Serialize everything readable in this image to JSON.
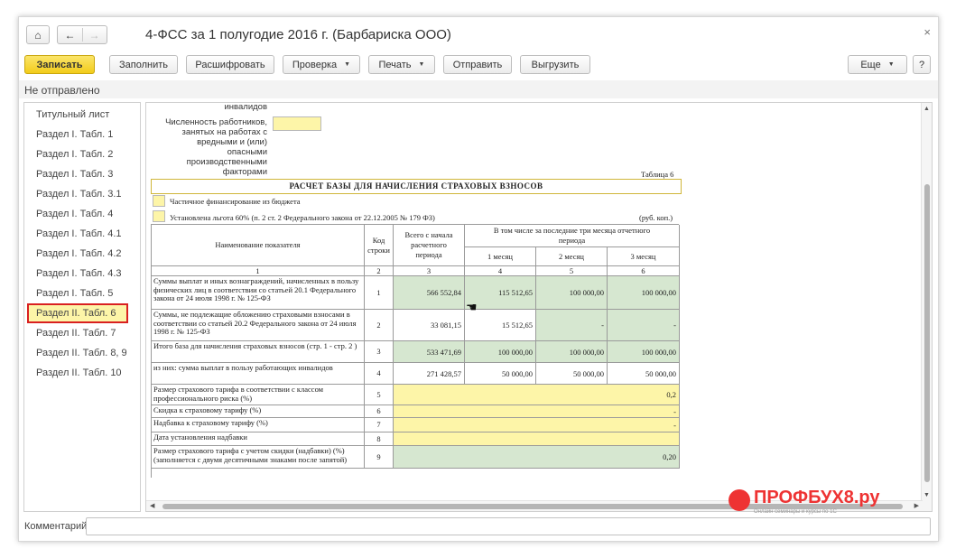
{
  "window": {
    "title": "4-ФСС за 1 полугодие 2016 г. (Барбариска ООО)",
    "close_glyph": "×"
  },
  "nav": {
    "home_glyph": "⌂",
    "back_glyph": "←",
    "forward_glyph": "→"
  },
  "toolbar": {
    "save": "Записать",
    "fill": "Заполнить",
    "decode": "Расшифровать",
    "check": "Проверка",
    "print": "Печать",
    "send": "Отправить",
    "upload": "Выгрузить",
    "more": "Еще",
    "help": "?"
  },
  "status": "Не отправлено",
  "sidebar": {
    "items": [
      {
        "label": "Титульный лист"
      },
      {
        "label": "Раздел I. Табл. 1"
      },
      {
        "label": "Раздел I. Табл. 2"
      },
      {
        "label": "Раздел I. Табл. 3"
      },
      {
        "label": "Раздел I. Табл. 3.1"
      },
      {
        "label": "Раздел I. Табл. 4"
      },
      {
        "label": "Раздел I. Табл. 4.1"
      },
      {
        "label": "Раздел I. Табл. 4.2"
      },
      {
        "label": "Раздел I. Табл. 4.3"
      },
      {
        "label": "Раздел I. Табл. 5"
      },
      {
        "label": "Раздел II. Табл. 6"
      },
      {
        "label": "Раздел II. Табл. 7"
      },
      {
        "label": "Раздел II. Табл. 8, 9"
      },
      {
        "label": "Раздел II. Табл. 10"
      }
    ],
    "active_index": 10
  },
  "form": {
    "truncated_label": "инвалидов",
    "workers_label": "Численность работников, занятых на работах с вредными и (или) опасными производственными факторами",
    "table_number": "Таблица 6",
    "calc_title": "РАСЧЕТ БАЗЫ ДЛЯ НАЧИСЛЕНИЯ СТРАХОВЫХ ВЗНОСОВ",
    "partial_financing": "Частичное финансирование из бюджета",
    "benefit": "Установлена льгота 60% (п. 2 ст. 2 Федерального закона от 22.12.2005 № 179 ФЗ)",
    "currency": "(руб. коп.)"
  },
  "table": {
    "headers": {
      "name": "Наименование показателя",
      "code": "Код строки",
      "total": "Всего с начала расчетного периода",
      "last_three": "В том числе за последние три месяца отчетного периода",
      "m1": "1 месяц",
      "m2": "2 месяц",
      "m3": "3 месяц"
    },
    "col_numbers": [
      "1",
      "2",
      "3",
      "4",
      "5",
      "6"
    ],
    "rows": [
      {
        "name": "Суммы выплат и иных вознаграждений, начисленных в пользу физических лиц в соответствии со статьей 20.1 Федерального закона от 24 июля 1998 г. № 125-ФЗ",
        "code": "1",
        "total": "566 552,84",
        "m1": "115 512,65",
        "m2": "100 000,00",
        "m3": "100 000,00"
      },
      {
        "name": "Суммы, не подлежащие обложению страховыми взносами в соответствии со статьей 20.2 Федерального закона от 24 июля 1998 г. № 125-ФЗ",
        "code": "2",
        "total": "33 081,15",
        "m1": "15 512,65",
        "m2": "-",
        "m3": "-"
      },
      {
        "name": "Итого база для начисления страховых взносов (стр. 1 - стр. 2 )",
        "code": "3",
        "total": "533 471,69",
        "m1": "100 000,00",
        "m2": "100 000,00",
        "m3": "100 000,00"
      },
      {
        "name": "из них: сумма выплат в пользу работающих инвалидов",
        "code": "4",
        "total": "271 428,57",
        "m1": "50 000,00",
        "m2": "50 000,00",
        "m3": "50 000,00"
      },
      {
        "name": "Размер страхового тарифа в соответствии с классом профессионального риска (%)",
        "code": "5",
        "value": "0,2"
      },
      {
        "name": "Скидка к страховому тарифу (%)",
        "code": "6",
        "value": "-"
      },
      {
        "name": "Надбавка к страховому тарифу (%)",
        "code": "7",
        "value": "-"
      },
      {
        "name": "Дата установления надбавки",
        "code": "8",
        "value": ""
      },
      {
        "name": "Размер страхового тарифа с учетом скидки (надбавки) (%) (заполняется с двумя десятичными знаками после запятой)",
        "code": "9",
        "value": "0,20"
      }
    ]
  },
  "watermark": {
    "text": "ПРОФБУХ8.ру",
    "sub": "ОНЛАЙН-СЕМИНАРЫ И КУРСЫ ПО 1С"
  },
  "brand": {
    "text": "ПРОФБУХ8.ру",
    "sub": "Онлайн семинары и курсы по 1С"
  },
  "comment": {
    "label": "Комментарий:",
    "value": ""
  },
  "cursor_glyph": "☚"
}
